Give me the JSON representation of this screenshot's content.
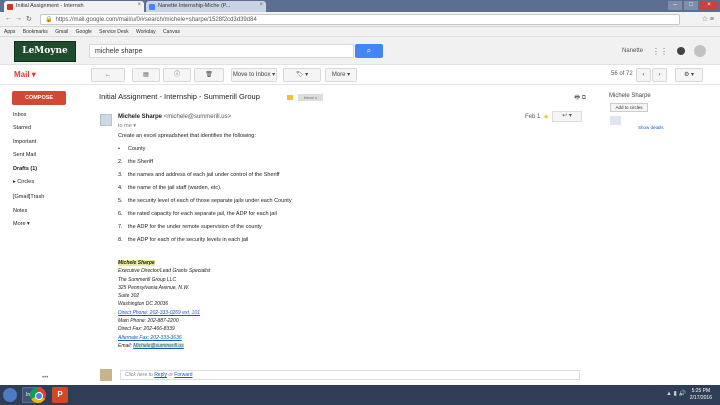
{
  "browser": {
    "tabs": [
      {
        "title": "Initial Assignment - Internsh",
        "active": true
      },
      {
        "title": "Nanette Internship-Miche (P...",
        "active": false
      }
    ],
    "url": "https://mail.google.com/mail/u/0/#search/michele+sharpe/1528f2cd3d39d84",
    "bookmarks": [
      "Apps",
      "Bookmarks",
      "Gmail",
      "Google",
      "Service Desk",
      "Workday",
      "Canvas"
    ]
  },
  "header": {
    "logo": "LeMoyne",
    "search_value": "michele sharpe",
    "user": "Nanette"
  },
  "toolbar": {
    "mail_label": "Mail ▾",
    "move_label": "Move to Inbox ▾",
    "more_label": "More ▾",
    "pager": "56 of 72"
  },
  "sidebar": {
    "compose": "COMPOSE",
    "items": [
      {
        "label": "Inbox",
        "bold": false
      },
      {
        "label": "Starred",
        "bold": false
      },
      {
        "label": "Important",
        "bold": false
      },
      {
        "label": "Sent Mail",
        "bold": false
      },
      {
        "label": "Drafts (1)",
        "bold": true
      },
      {
        "label": "▸ Circles",
        "bold": false
      },
      {
        "label": "[Gmail]Trash",
        "bold": false
      },
      {
        "label": "Notes",
        "bold": false
      },
      {
        "label": "More ▾",
        "bold": false
      }
    ]
  },
  "message": {
    "subject": "Initial Assignment - Internship - Summerill Group",
    "inbox_chip": "Inbox x",
    "sender_name": "Michele Sharpe",
    "sender_email": "<michele@summerill.us>",
    "to_line": "to me ▾",
    "date": "Feb 1",
    "intro": "Create an excel spreadsheet that identifies the following:",
    "items": [
      "County",
      "the Sheriff",
      "the names and address of each jail under control of the Sheriff",
      "the name of the jail staff (warden, etc).",
      "the security level of each of those separate jails under each County",
      "the rated capacity for each separate jail, the ADP for each jail",
      "the ADP for the under remote supervision of the county",
      "the ADP for each of the security levels in each jail"
    ],
    "signature": {
      "name": "Michele Sharpe",
      "title": "Executive Director/Lead Grants Specialist",
      "company": "The Summerill Group LLC",
      "address1": "325 Pennsylvania Avenue, N.W.",
      "suite": "Suite 302",
      "city": "Washington DC 20036",
      "direct": "Direct Phone: 202-333-0269 ext. 101",
      "main": "Main Phone: 202-887-2200",
      "fax": "Direct Fax: 202-466-8339",
      "alt": "Alternate Fax: 202-333-3636",
      "email_label": "Email:",
      "email": "Michele@summerill.us"
    },
    "reply_prompt": "Click here to",
    "reply_link": "Reply",
    "reply_or": "or",
    "forward_link": "Forward"
  },
  "contact_panel": {
    "name": "Michele Sharpe",
    "add_circles": "Add to circles",
    "show_details": "Show details"
  },
  "taskbar": {
    "items": [
      "Inbox"
    ],
    "time": "5:25 PM",
    "date": "2/17/2016"
  }
}
